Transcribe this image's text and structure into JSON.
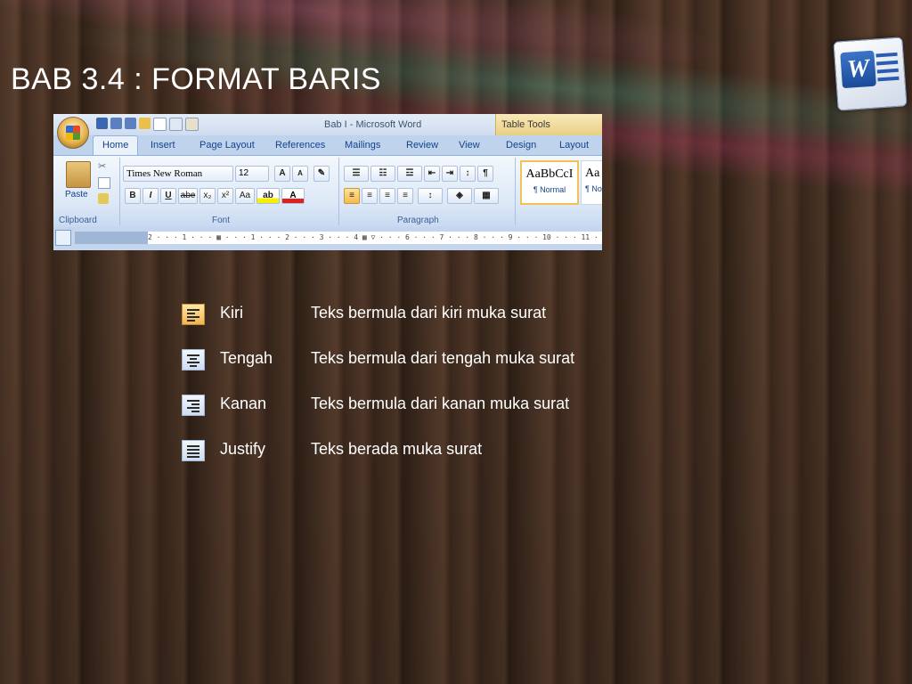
{
  "slide": {
    "title": "BAB 3.4 : FORMAT BARIS"
  },
  "word_logo": {
    "letter": "W",
    "icon": "word-logo-icon"
  },
  "ribbon": {
    "window_title": "Bab I - Microsoft Word",
    "contextual_title": "Table Tools",
    "tabs": [
      "Home",
      "Insert",
      "Page Layout",
      "References",
      "Mailings",
      "Review",
      "View",
      "Design",
      "Layout"
    ],
    "clipboard": {
      "paste_label": "Paste",
      "group_label": "Clipboard"
    },
    "font": {
      "name": "Times New Roman",
      "size": "12",
      "group_label": "Font",
      "buttons": [
        "B",
        "I",
        "U",
        "abe",
        "x₂",
        "x²",
        "Aa"
      ]
    },
    "paragraph": {
      "group_label": "Paragraph"
    },
    "styles": {
      "normal_preview": "AaBbCcI",
      "normal_label": "¶ Normal",
      "next_preview": "Aa",
      "next_label": "¶ No"
    },
    "ruler_text": "2 · · · 1 · · · ▦ · · · 1 · · · 2 · · · 3 · · · 4 ▦ ▽ · · · 6 · · · 7 · · · 8 · · · 9 · · · 10 · · · 11 · · · 12"
  },
  "alignments": [
    {
      "label": "Kiri",
      "desc": "Teks bermula dari kiri muka surat",
      "icon": "align-left-icon",
      "active": true
    },
    {
      "label": "Tengah",
      "desc": "Teks bermula dari tengah muka surat",
      "icon": "align-center-icon",
      "active": false
    },
    {
      "label": "Kanan",
      "desc": "Teks bermula dari kanan muka surat",
      "icon": "align-right-icon",
      "active": false
    },
    {
      "label": "Justify",
      "desc": "Teks berada muka surat",
      "icon": "align-justify-icon",
      "active": false
    }
  ],
  "colors": {
    "title_text": "#ffffff",
    "ribbon_text": "#15428b",
    "active_button": "#f6b84e"
  }
}
